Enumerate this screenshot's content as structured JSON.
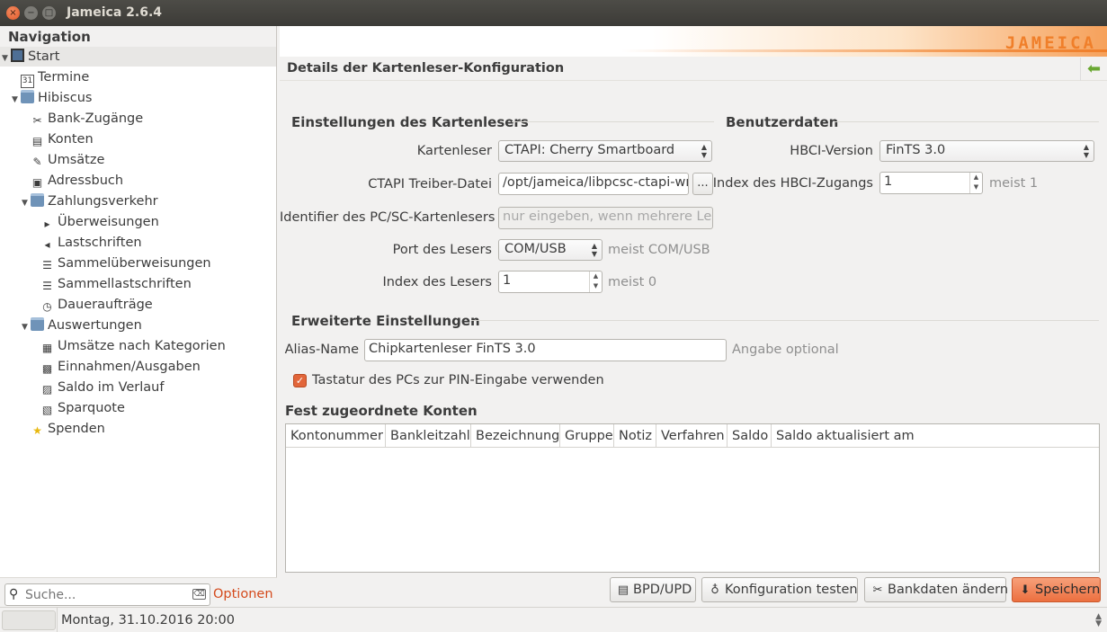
{
  "window": {
    "title": "Jameica 2.6.4",
    "close": "×",
    "minimize": "−",
    "maximize": "□"
  },
  "nav": {
    "header": "Navigation",
    "items": [
      {
        "label": "Start",
        "icon": "computer-icon",
        "glyph": "",
        "level": 0,
        "expanded": true,
        "selected": true
      },
      {
        "label": "Termine",
        "icon": "calendar-icon",
        "glyph": "31",
        "level": 1
      },
      {
        "label": "Hibiscus",
        "icon": "folder-icon",
        "glyph": "",
        "level": 1,
        "expanded": true
      },
      {
        "label": "Bank-Zugänge",
        "icon": "tools-icon",
        "glyph": "✂",
        "level": 2
      },
      {
        "label": "Konten",
        "icon": "accounts-icon",
        "glyph": "▤",
        "level": 2
      },
      {
        "label": "Umsätze",
        "icon": "transactions-icon",
        "glyph": "✎",
        "level": 2
      },
      {
        "label": "Adressbuch",
        "icon": "addressbook-icon",
        "glyph": "▣",
        "level": 2
      },
      {
        "label": "Zahlungsverkehr",
        "icon": "folder-icon",
        "glyph": "",
        "level": 2,
        "expanded": true
      },
      {
        "label": "Überweisungen",
        "icon": "transfer-icon",
        "glyph": "▸",
        "level": 3
      },
      {
        "label": "Lastschriften",
        "icon": "debit-icon",
        "glyph": "◂",
        "level": 3
      },
      {
        "label": "Sammelüberweisungen",
        "icon": "bulk-transfer-icon",
        "glyph": "☰",
        "level": 3
      },
      {
        "label": "Sammellastschriften",
        "icon": "bulk-debit-icon",
        "glyph": "☰",
        "level": 3
      },
      {
        "label": "Daueraufträge",
        "icon": "clock-icon",
        "glyph": "◷",
        "level": 3
      },
      {
        "label": "Auswertungen",
        "icon": "folder-icon",
        "glyph": "",
        "level": 2,
        "expanded": true
      },
      {
        "label": "Umsätze nach Kategorien",
        "icon": "chart-icon",
        "glyph": "▦",
        "level": 3
      },
      {
        "label": "Einnahmen/Ausgaben",
        "icon": "money-icon",
        "glyph": "▩",
        "level": 3
      },
      {
        "label": "Saldo im Verlauf",
        "icon": "line-chart-icon",
        "glyph": "▨",
        "level": 3
      },
      {
        "label": "Sparquote",
        "icon": "savings-icon",
        "glyph": "▧",
        "level": 3
      },
      {
        "label": "Spenden",
        "icon": "star-icon",
        "glyph": "★",
        "level": 2
      }
    ],
    "search_placeholder": "Suche...",
    "options": "Optionen"
  },
  "banner": {
    "logo": "JAMEICA"
  },
  "page": {
    "title": "Details der Kartenleser-Konfiguration",
    "reader_section": {
      "title": "Einstellungen des Kartenlesers",
      "kartenleser_label": "Kartenleser",
      "kartenleser_value": "CTAPI: Cherry Smartboard",
      "treiber_label": "CTAPI Treiber-Datei",
      "treiber_value": "/opt/jameica/libpcsc-ctapi-wrapper.so",
      "browse": "...",
      "identifier_label": "Identifier des PC/SC-Kartenlesers",
      "identifier_placeholder": "nur eingeben, wenn mehrere Leser",
      "port_label": "Port des Lesers",
      "port_value": "COM/USB",
      "port_hint": "meist COM/USB",
      "index_label": "Index des Lesers",
      "index_value": "1",
      "index_hint": "meist 0"
    },
    "user_section": {
      "title": "Benutzerdaten",
      "hbci_label": "HBCI-Version",
      "hbci_value": "FinTS 3.0",
      "zugang_label": "Index des HBCI-Zugangs",
      "zugang_value": "1",
      "zugang_hint": "meist 1"
    },
    "advanced_section": {
      "title": "Erweiterte Einstellungen",
      "alias_label": "Alias-Name",
      "alias_value": "Chipkartenleser FinTS 3.0",
      "alias_hint": "Angabe optional",
      "pin_label": "Tastatur des PCs zur PIN-Eingabe verwenden",
      "pin_checked": true
    },
    "accounts": {
      "title": "Fest zugeordnete Konten",
      "columns": [
        "Kontonummer",
        "Bankleitzahl",
        "Bezeichnung",
        "Gruppe",
        "Notiz",
        "Verfahren",
        "Saldo",
        "Saldo aktualisiert am"
      ],
      "rows": []
    },
    "buttons": {
      "bpd": "BPD/UPD",
      "test": "Konfiguration testen",
      "bankdata": "Bankdaten ändern",
      "save": "Speichern"
    }
  },
  "status": {
    "text": "Montag, 31.10.2016 20:00"
  },
  "colors": {
    "accent": "#f07f2a",
    "primary_button": "#ec6f3f",
    "link": "#d44a1c"
  }
}
